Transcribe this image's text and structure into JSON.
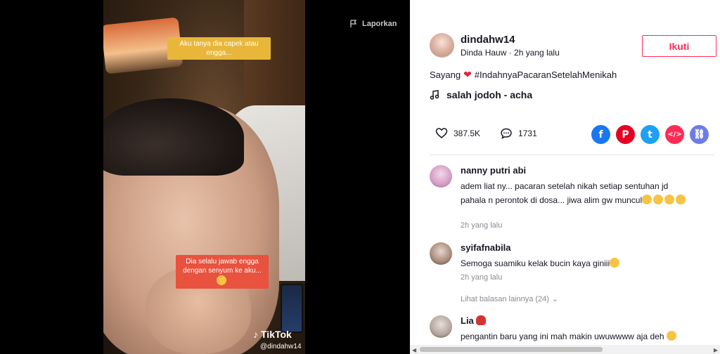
{
  "video": {
    "report_label": "Laporkan",
    "caption_top": "Aku tanya dia capek atau engga...",
    "caption_bottom": "Dia selalu jawab engga dengan senyum ke aku...",
    "watermark_logo": "TikTok",
    "watermark_handle": "@dindahw14"
  },
  "post": {
    "username": "dindahw14",
    "subtitle": "Dinda Hauw · 2h yang lalu",
    "follow_label": "Ikuti",
    "desc_prefix": "Sayang",
    "hashtag": "#IndahnyaPacaranSetelahMenikah",
    "music": "salah jodoh - acha",
    "likes": "387.5K",
    "comments_count": "1731"
  },
  "share": [
    {
      "name": "facebook-icon",
      "glyph": "f",
      "color": "#1877f2"
    },
    {
      "name": "pinterest-icon",
      "glyph": "P",
      "color": "#e60023"
    },
    {
      "name": "twitter-icon",
      "glyph": "t",
      "color": "#1da1f2"
    },
    {
      "name": "embed-icon",
      "glyph": "</>",
      "color": "#fe2c55"
    },
    {
      "name": "link-icon",
      "glyph": "⛓",
      "color": "#6c7ce6"
    }
  ],
  "comments": [
    {
      "name": "nanny putri abi",
      "text": "adem liat ny... pacaran setelah nikah setiap sentuhan jd pahala n perontok di dosa... jiwa alim gw muncul",
      "time": "2h yang lalu"
    },
    {
      "name": "syifafnabila",
      "text": "Semoga suamiku kelak bucin kaya giniii",
      "time": "2h yang lalu"
    },
    {
      "name": "Lia",
      "text": "pengantin baru yang ini mah makin uwuwwww aja deh",
      "time": ""
    }
  ],
  "more_replies": "Lihat balasan lainnya (24)"
}
